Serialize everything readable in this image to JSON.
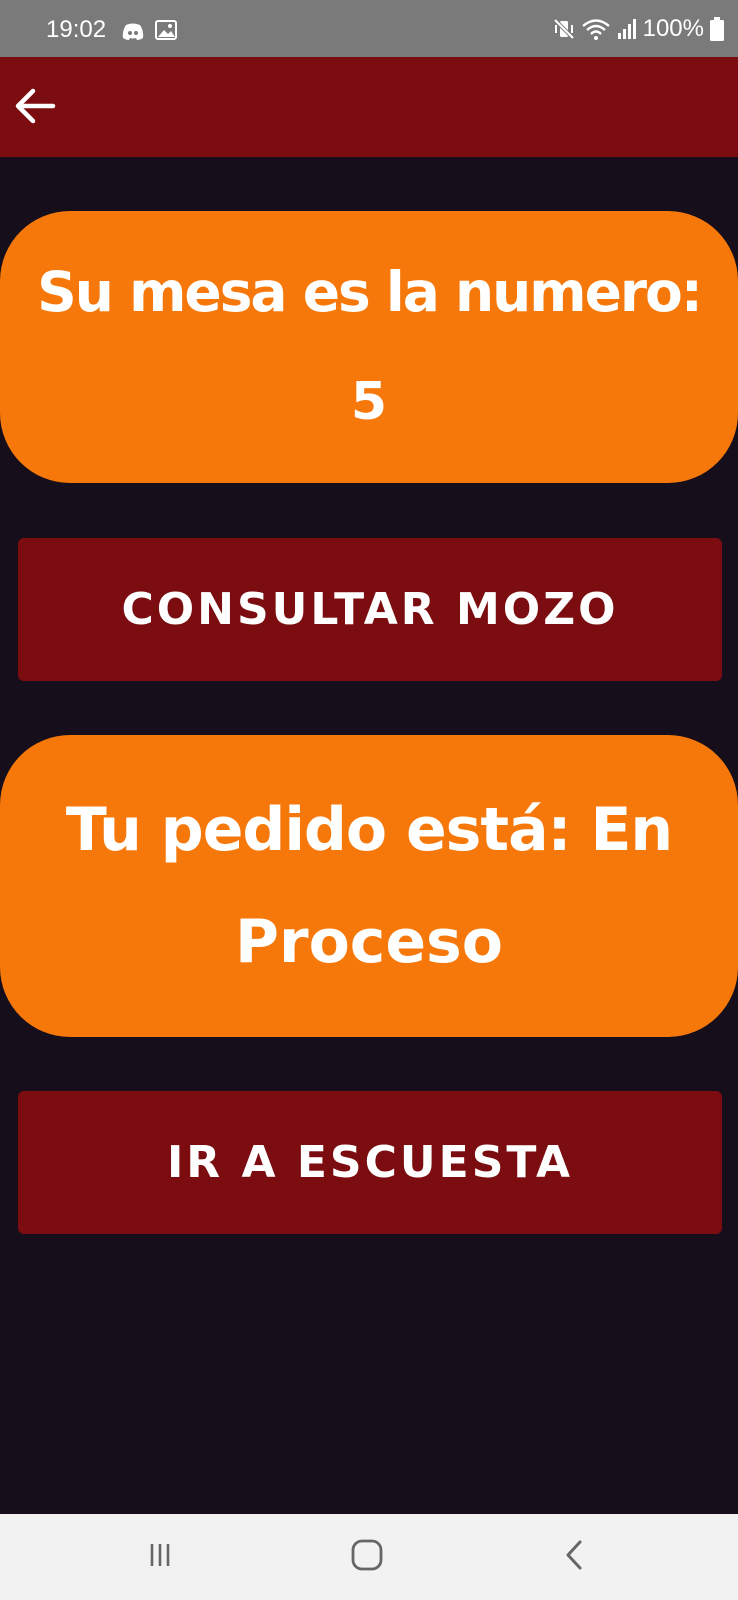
{
  "status_bar": {
    "time": "19:02",
    "battery": "100%",
    "icons": [
      "discord-icon",
      "gallery-icon",
      "mute-vibrate-icon",
      "wifi-icon",
      "signal-icon",
      "battery-icon"
    ]
  },
  "app_bar": {
    "back_icon": "arrow-left-icon"
  },
  "table_card": {
    "line1": "Su mesa es la numero:",
    "line2": "5"
  },
  "consult_button": {
    "label": "CONSULTAR MOZO"
  },
  "order_card": {
    "line1": "Tu pedido está: En",
    "line2": "Proceso"
  },
  "survey_button": {
    "label": "IR A ESCUESTA"
  },
  "nav_bar": {
    "icons": [
      "recents-icon",
      "home-icon",
      "back-icon"
    ]
  },
  "colors": {
    "background": "#160e1b",
    "app_bar": "#7b0c0f",
    "card_orange": "#f6780a",
    "button_red": "#7b0c0f",
    "status_bar": "#7a7a7a",
    "nav_bar": "#f2f2f2"
  }
}
